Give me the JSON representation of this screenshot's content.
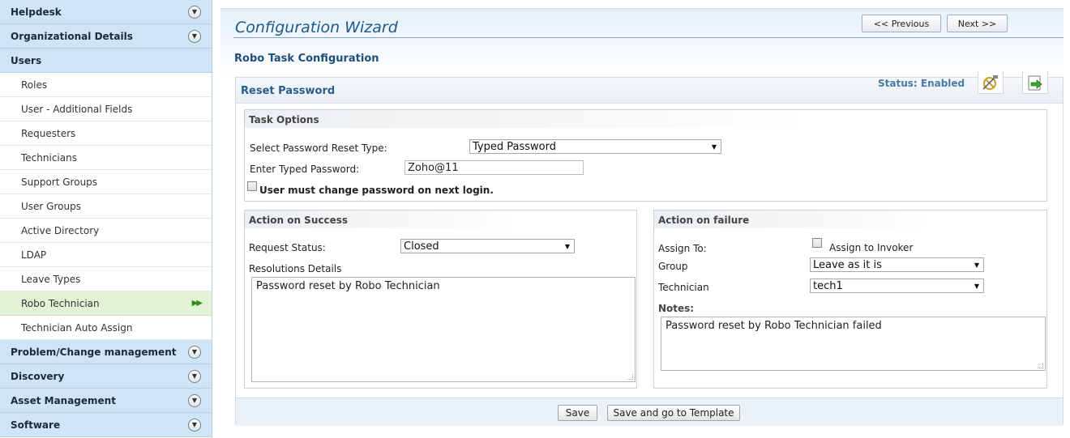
{
  "sidebar": {
    "sections": [
      {
        "label": "Helpdesk"
      },
      {
        "label": "Organizational Details"
      }
    ],
    "users_header": "Users",
    "items": [
      {
        "label": "Roles"
      },
      {
        "label": "User - Additional Fields"
      },
      {
        "label": "Requesters"
      },
      {
        "label": "Technicians"
      },
      {
        "label": "Support Groups"
      },
      {
        "label": "User Groups"
      },
      {
        "label": "Active Directory"
      },
      {
        "label": "LDAP"
      },
      {
        "label": "Leave Types"
      },
      {
        "label": "Robo Technician"
      },
      {
        "label": "Technician Auto Assign"
      }
    ],
    "bottom_sections": [
      {
        "label": "Problem/Change management"
      },
      {
        "label": "Discovery"
      },
      {
        "label": "Asset Management"
      },
      {
        "label": "Software"
      }
    ]
  },
  "header": {
    "title": "Configuration Wizard",
    "subtitle": "Robo Task Configuration",
    "previous_label": "<< Previous",
    "next_label": "Next >>"
  },
  "panel": {
    "title": "Reset Password",
    "status": "Status: Enabled",
    "icons": [
      "disable-icon",
      "export-icon"
    ]
  },
  "task_options": {
    "legend": "Task Options",
    "reset_type_label": "Select Password Reset Type:",
    "reset_type_value": "Typed Password",
    "typed_password_label": "Enter Typed Password:",
    "typed_password_value": "Zoho@11",
    "must_change_label": "User must change password on next login."
  },
  "success": {
    "legend": "Action on Success",
    "request_status_label": "Request Status:",
    "request_status_value": "Closed",
    "resolution_label": "Resolutions Details",
    "resolution_value": "Password reset by Robo Technician"
  },
  "failure": {
    "legend": "Action on failure",
    "assign_to_label": "Assign To:",
    "assign_invoker_label": "Assign to Invoker",
    "group_label": "Group",
    "group_value": "Leave as it is",
    "technician_label": "Technician",
    "technician_value": "tech1",
    "notes_label": "Notes:",
    "notes_value": "Password reset by Robo Technician failed"
  },
  "footer": {
    "save_label": "Save",
    "save_template_label": "Save and go to Template"
  },
  "colors": {
    "sidebar_header_bg": "#cfe5f5",
    "selected_item_bg": "#e3f4d6",
    "title_blue": "#1e5a8c",
    "status_blue": "#4a7aa6"
  }
}
